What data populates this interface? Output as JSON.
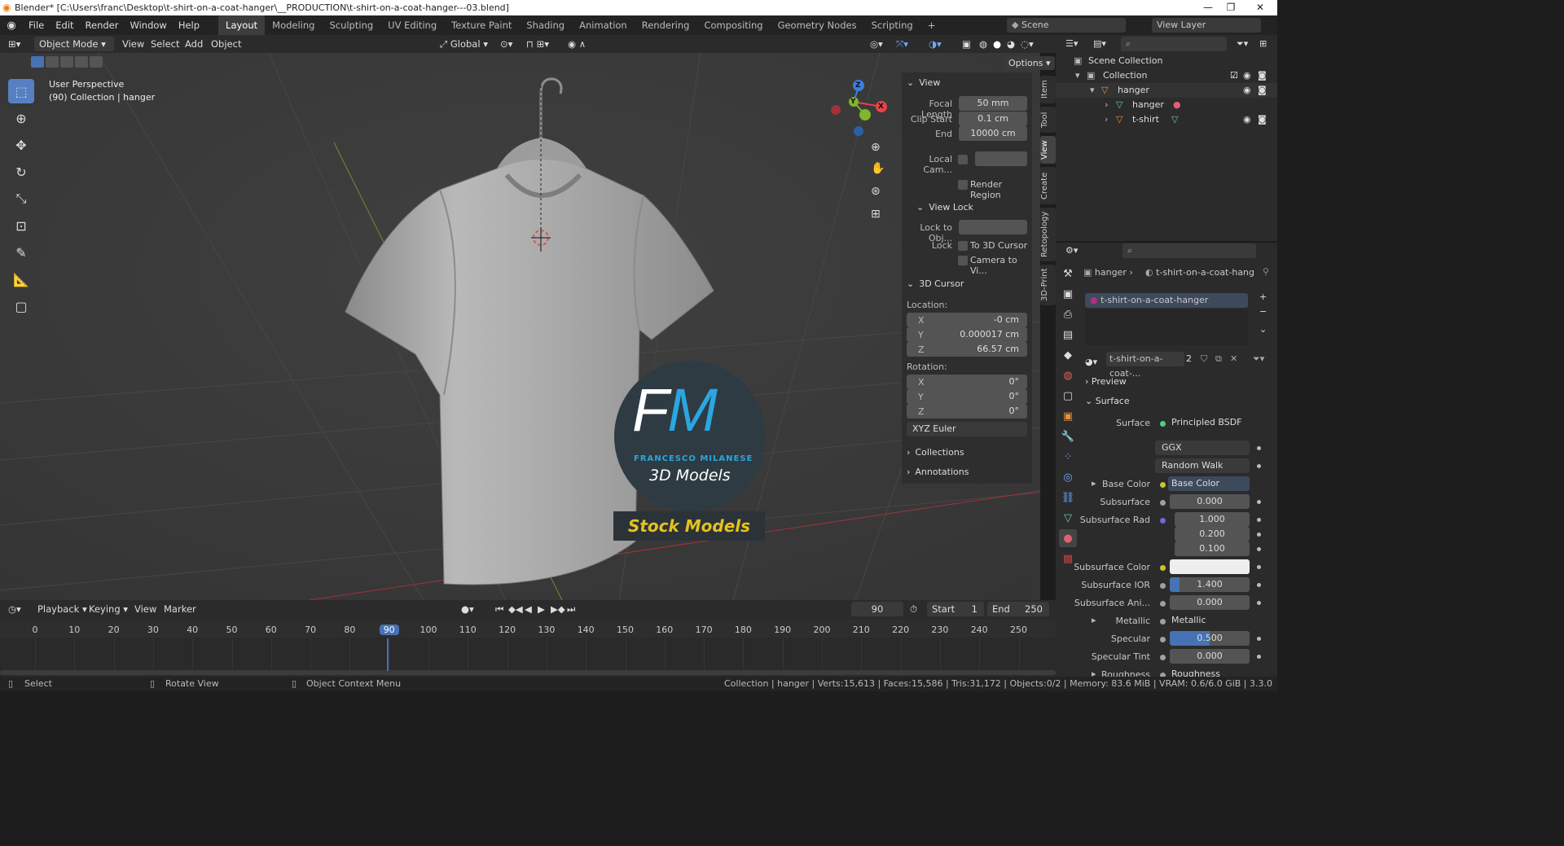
{
  "window": {
    "title": "Blender* [C:\\Users\\franc\\Desktop\\t-shirt-on-a-coat-hanger\\__PRODUCTION\\t-shirt-on-a-coat-hanger---03.blend]",
    "minimize": "—",
    "maximize": "❐",
    "close": "✕"
  },
  "menu": [
    "File",
    "Edit",
    "Render",
    "Window",
    "Help"
  ],
  "workspaces": [
    "Layout",
    "Modeling",
    "Sculpting",
    "UV Editing",
    "Texture Paint",
    "Shading",
    "Animation",
    "Rendering",
    "Compositing",
    "Geometry Nodes",
    "Scripting"
  ],
  "active_workspace": "Layout",
  "scene": {
    "name": "Scene",
    "view_layer": "View Layer"
  },
  "viewport_header": {
    "mode": "Object Mode",
    "menus": [
      "View",
      "Select",
      "Add",
      "Object"
    ],
    "transform_orientation": "Global",
    "options": "Options"
  },
  "viewport": {
    "perspective": "User Perspective",
    "collection_info": "(90) Collection | hanger",
    "watermark": {
      "initials": "FM",
      "name": "FRANCESCO MILANESE",
      "subtitle": "3D Models",
      "banner": "Stock Models"
    },
    "gizmo_axes": [
      "Z",
      "Y",
      "X"
    ]
  },
  "sidebar_tabs": [
    "Item",
    "Tool",
    "View",
    "Create",
    "Retopology",
    "3D-Print"
  ],
  "active_sidebar_tab": "View",
  "npanel": {
    "view_header": "View",
    "focal_length_label": "Focal Length",
    "focal_length": "50 mm",
    "clip_start_label": "Clip Start",
    "clip_start": "0.1 cm",
    "end_label": "End",
    "end": "10000 cm",
    "local_camera_label": "Local Cam...",
    "render_region_label": "Render Region",
    "view_lock_header": "View Lock",
    "lock_to_obj_label": "Lock to Obj...",
    "lock_label": "Lock",
    "to_3d_cursor_label": "To 3D Cursor",
    "camera_to_view_label": "Camera to Vi...",
    "cursor_header": "3D Cursor",
    "location_label": "Location:",
    "loc_x": "-0 cm",
    "loc_y": "0.000017 cm",
    "loc_z": "66.57 cm",
    "rotation_label": "Rotation:",
    "rot_x": "0°",
    "rot_y": "0°",
    "rot_z": "0°",
    "rotation_mode": "XYZ Euler",
    "collections_header": "Collections",
    "annotations_header": "Annotations"
  },
  "outliner": {
    "scene_collection": "Scene Collection",
    "collection": "Collection",
    "items": [
      "hanger",
      "hanger",
      "t-shirt"
    ]
  },
  "properties": {
    "breadcrumb_object": "hanger",
    "breadcrumb_material": "t-shirt-on-a-coat-hang",
    "material_slot": "t-shirt-on-a-coat-hanger",
    "material_name": "t-shirt-on-a-coat-...",
    "user_count": "2",
    "preview_header": "Preview",
    "surface_header": "Surface",
    "surface_label": "Surface",
    "surface_value": "Principled BSDF",
    "distribution": "GGX",
    "subsurface_method": "Random Walk",
    "base_color_label": "Base Color",
    "base_color_value": "Base Color",
    "subsurface_label": "Subsurface",
    "subsurface_value": "0.000",
    "subsurface_rad_label": "Subsurface Rad",
    "subsurface_rad": [
      "1.000",
      "0.200",
      "0.100"
    ],
    "subsurface_color_label": "Subsurface Color",
    "subsurface_ior_label": "Subsurface IOR",
    "subsurface_ior": "1.400",
    "subsurface_ani_label": "Subsurface Ani...",
    "subsurface_ani": "0.000",
    "metallic_label": "Metallic",
    "metallic_value": "Metallic",
    "specular_label": "Specular",
    "specular_value": "0.500",
    "specular_tint_label": "Specular Tint",
    "specular_tint_value": "0.000",
    "roughness_label": "Roughness",
    "roughness_value": "Roughness"
  },
  "timeline": {
    "menus": [
      "Playback",
      "Keying",
      "View",
      "Marker"
    ],
    "current_frame": "90",
    "start_label": "Start",
    "start": "1",
    "end_label": "End",
    "end": "250",
    "ticks": [
      "0",
      "10",
      "20",
      "30",
      "40",
      "50",
      "60",
      "70",
      "80",
      "90",
      "100",
      "110",
      "120",
      "130",
      "140",
      "150",
      "160",
      "170",
      "180",
      "190",
      "200",
      "210",
      "220",
      "230",
      "240",
      "250"
    ]
  },
  "statusbar": {
    "select": "Select",
    "rotate": "Rotate View",
    "context_menu": "Object Context Menu",
    "stats": "Collection | hanger | Verts:15,613 | Faces:15,586 | Tris:31,172 | Objects:0/2 | Memory: 83.6 MiB | VRAM: 0.6/6.0 GiB | 3.3.0"
  },
  "colors": {
    "accent": "#4772b3",
    "active_tool": "#5680c2",
    "watermark_blue": "#2aa6e0",
    "watermark_yellow": "#e5c21e",
    "x_axis": "#e8424a",
    "y_axis": "#7fb62b",
    "z_axis": "#3b7fe0"
  }
}
